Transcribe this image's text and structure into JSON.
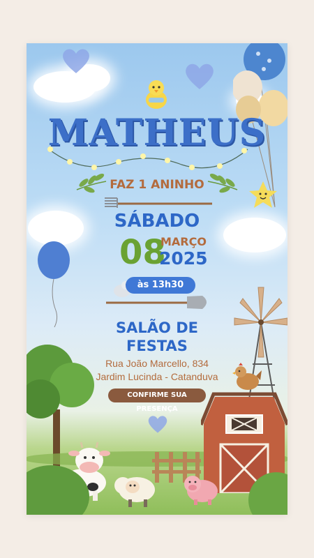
{
  "invite": {
    "name": "MATHEUS",
    "subtitle": "FAZ 1 ANINHO",
    "weekday": "SÁBADO",
    "day": "08",
    "month": "MARÇO",
    "year": "2025",
    "time": "às 13h30",
    "venue_line1": "SALÃO DE",
    "venue_line2": "FESTAS",
    "address_line1": "Rua João Marcello, 834",
    "address_line2": "Jardim Lucinda - Catanduva",
    "confirm_label": "CONFIRME SUA PRESENÇA"
  },
  "colors": {
    "name_blue": "#3c6fc8",
    "accent_blue": "#2d67c7",
    "green": "#6aa233",
    "brown": "#b36b3d",
    "pill_blue": "#3f78d6",
    "confirm_brown": "#8a5a3e"
  },
  "decorations": [
    "heart-icon",
    "chick-icon",
    "balloon-icon",
    "star-icon",
    "cloud",
    "rake-icon",
    "shovel-icon",
    "bird-icon",
    "tree",
    "windmill",
    "barn",
    "hen-icon",
    "cow-icon",
    "sheep-icon",
    "pig-icon",
    "fence"
  ]
}
